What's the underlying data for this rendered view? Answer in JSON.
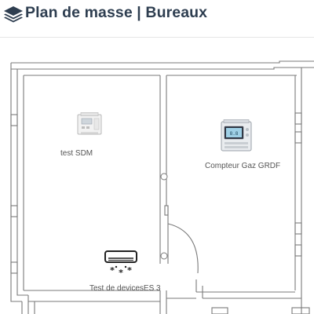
{
  "header": {
    "icon": "layers-icon",
    "title": "Plan de masse | Bureaux"
  },
  "floor_plan": {
    "devices": [
      {
        "icon": "energy-meter-icon",
        "label": "test SDM"
      },
      {
        "icon": "gas-meter-icon",
        "label": "Compteur Gaz GRDF"
      },
      {
        "icon": "air-conditioner-icon",
        "label": "Test de devicesES 3"
      }
    ]
  },
  "colors": {
    "title": "#2e3e50",
    "wall": "#7a7a7a",
    "device_label": "#555555"
  }
}
